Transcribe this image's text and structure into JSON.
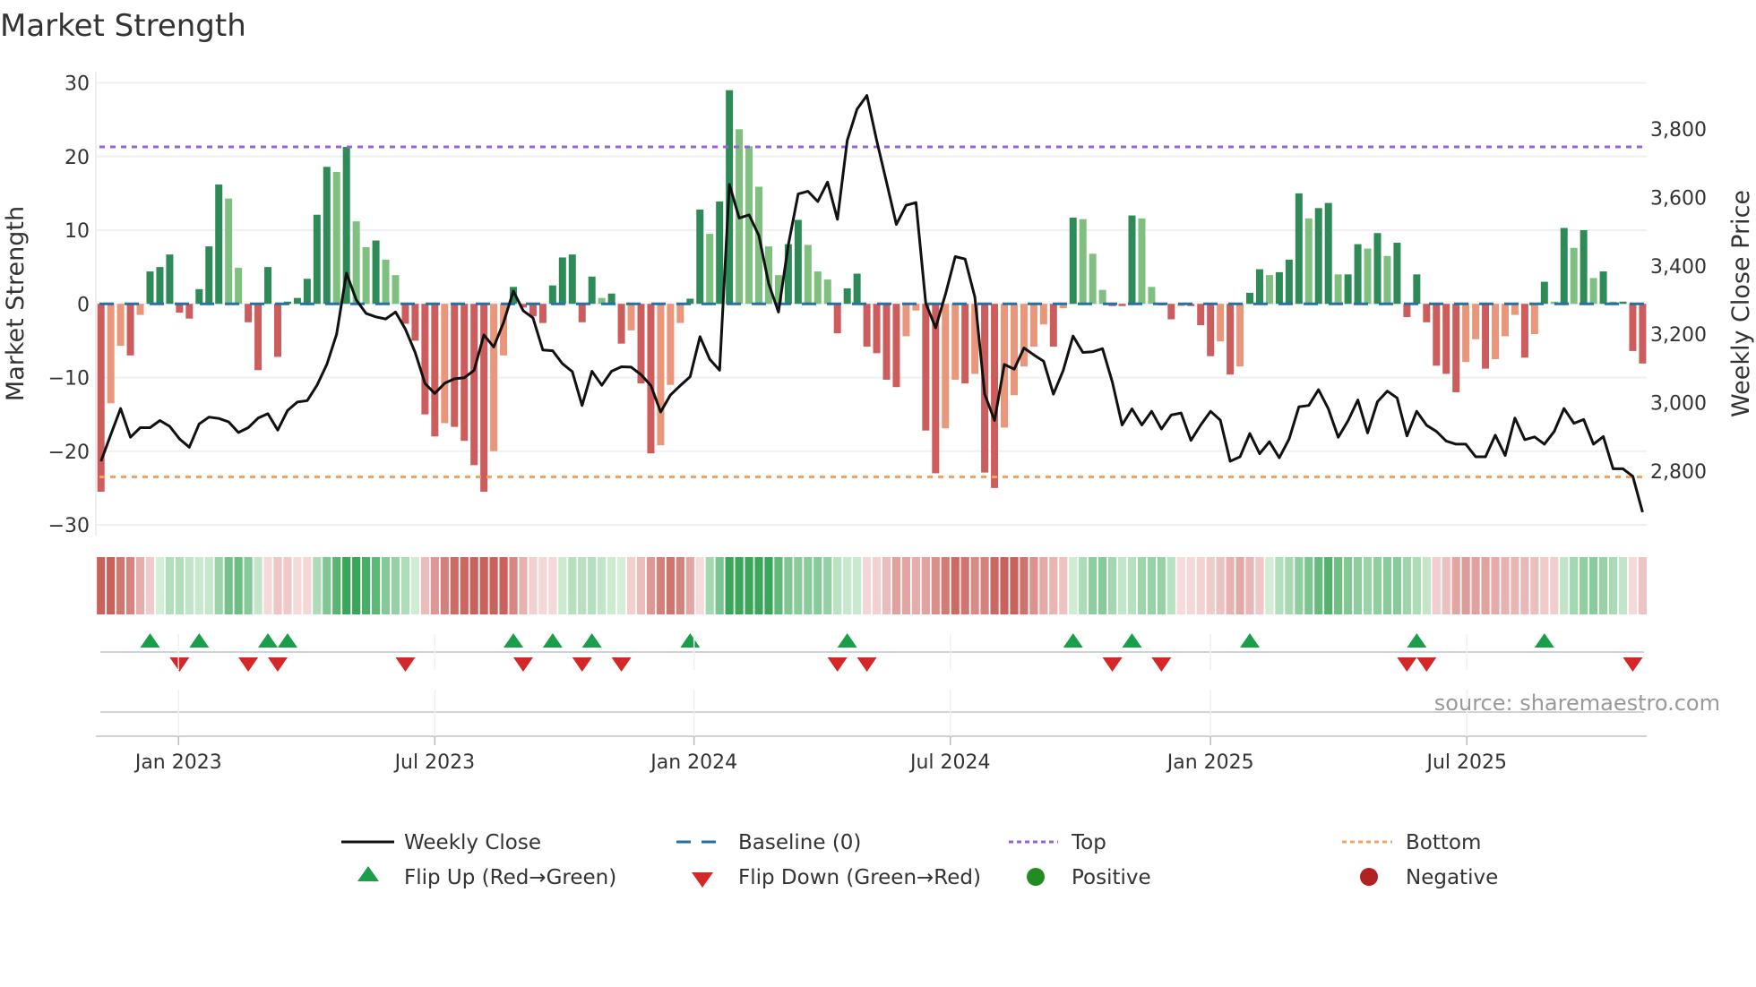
{
  "chart_data": {
    "type": "bar+line",
    "title": "Market Strength",
    "ylabel": "Market Strength",
    "y2label": "Weekly Close Price",
    "ylim": [
      -30,
      30
    ],
    "yticks": [
      {
        "value": 30,
        "label": "30"
      },
      {
        "value": 20,
        "label": "20"
      },
      {
        "value": 10,
        "label": "10"
      },
      {
        "value": 0,
        "label": "0"
      },
      {
        "value": -10,
        "label": "−10"
      },
      {
        "value": -20,
        "label": "−20"
      },
      {
        "value": -30,
        "label": "−30"
      }
    ],
    "y2lim": [
      2643,
      3935
    ],
    "y2ticks": [
      {
        "value": 2800,
        "label": "2,800"
      },
      {
        "value": 3000,
        "label": "3,000"
      },
      {
        "value": 3200,
        "label": "3,200"
      },
      {
        "value": 3400,
        "label": "3,400"
      },
      {
        "value": 3600,
        "label": "3,600"
      },
      {
        "value": 3800,
        "label": "3,800"
      }
    ],
    "xticks": [
      {
        "week": 7.9,
        "label": "Jan 2023"
      },
      {
        "week": 34.0,
        "label": "Jul 2023"
      },
      {
        "week": 60.4,
        "label": "Jan 2024"
      },
      {
        "week": 86.5,
        "label": "Jul 2024"
      },
      {
        "week": 113.0,
        "label": "Jan 2025"
      },
      {
        "week": 139.1,
        "label": "Jul 2025"
      }
    ],
    "top_level": 21.3,
    "bottom_level": -23.5,
    "baseline": 0,
    "strength": [
      -25.5,
      -13.5,
      -5.7,
      -7,
      -1.5,
      4.4,
      5,
      6.7,
      -1.2,
      -2,
      2,
      7.8,
      16.2,
      14.3,
      4.9,
      -2.5,
      -9,
      5,
      -7.2,
      0.3,
      0.8,
      3.4,
      12.1,
      18.6,
      17.9,
      21.3,
      11.2,
      7.7,
      8.6,
      6.0,
      3.9,
      -2.7,
      -5,
      -15,
      -18,
      -16.2,
      -16.7,
      -18.6,
      -21.9,
      -25.5,
      -20,
      -7,
      2.3,
      -0.5,
      -1.7,
      -2.6,
      2.5,
      6.3,
      6.7,
      -2.5,
      3.7,
      0.8,
      1.4,
      -5.4,
      -3.6,
      -10.8,
      -20.3,
      -19.2,
      -11,
      -2.6,
      0.7,
      12.8,
      9.5,
      13.9,
      29,
      23.7,
      21.4,
      15.9,
      7.8,
      3.9,
      8.1,
      11.4,
      8,
      4.4,
      3.3,
      -4,
      2.1,
      4.1,
      -5.8,
      -6.7,
      -10.3,
      -11.3,
      -4.4,
      -0.9,
      -17.2,
      -23,
      -16.9,
      -10.3,
      -10.8,
      -9.5,
      -22.9,
      -25,
      -16.8,
      -12.4,
      -8.5,
      -5.8,
      -2.8,
      -5.8,
      -0.6,
      11.7,
      11.5,
      6.8,
      1.9,
      -0.3,
      -0.3,
      12,
      11.6,
      2.3,
      -0.2,
      -2.1,
      -0.3,
      -0.3,
      -2.9,
      -7.1,
      -5.1,
      -9.6,
      -8.5,
      1.5,
      4.7,
      3.9,
      4.3,
      6,
      15,
      11.6,
      13,
      13.7,
      4,
      4,
      8.1,
      7.5,
      9.6,
      6.5,
      8.3,
      -1.8,
      4.0,
      -2.5,
      -8.4,
      -9.5,
      -12,
      -7.9,
      -4.8,
      -8.8,
      -7.5,
      -4.4,
      -1.5,
      -7.3,
      -4.1,
      3.0,
      0.3,
      10.3,
      7.6,
      10.0,
      3.5,
      4.4,
      0.3,
      0.3,
      -6.4,
      -8.1
    ],
    "close": [
      2829,
      2907,
      2983,
      2899,
      2927,
      2927,
      2948,
      2931,
      2894,
      2870,
      2938,
      2958,
      2954,
      2944,
      2913,
      2927,
      2955,
      2968,
      2920,
      2977,
      3002,
      3006,
      3051,
      3112,
      3200,
      3379,
      3300,
      3261,
      3251,
      3245,
      3265,
      3215,
      3147,
      3056,
      3027,
      3057,
      3070,
      3073,
      3095,
      3198,
      3163,
      3235,
      3326,
      3269,
      3248,
      3154,
      3152,
      3114,
      3091,
      2992,
      3092,
      3051,
      3092,
      3105,
      3104,
      3082,
      3050,
      2973,
      3023,
      3050,
      3076,
      3193,
      3127,
      3095,
      3638,
      3540,
      3549,
      3489,
      3348,
      3265,
      3461,
      3610,
      3618,
      3588,
      3645,
      3536,
      3767,
      3858,
      3898,
      3767,
      3645,
      3521,
      3577,
      3585,
      3291,
      3219,
      3317,
      3427,
      3420,
      3309,
      3025,
      2948,
      3112,
      3098,
      3160,
      3140,
      3121,
      3025,
      3095,
      3195,
      3147,
      3149,
      3158,
      3060,
      2935,
      2982,
      2935,
      2975,
      2923,
      2964,
      2970,
      2890,
      2935,
      2975,
      2949,
      2829,
      2842,
      2910,
      2851,
      2886,
      2839,
      2894,
      2988,
      2992,
      3038,
      2982,
      2899,
      2947,
      3008,
      2912,
      3003,
      3034,
      3014,
      2903,
      2975,
      2934,
      2916,
      2888,
      2879,
      2879,
      2842,
      2842,
      2905,
      2846,
      2955,
      2892,
      2900,
      2879,
      2916,
      2983,
      2940,
      2951,
      2879,
      2901,
      2807,
      2807,
      2785,
      2680
    ],
    "legend": {
      "placement": "bottom",
      "weekly_close": "Weekly Close",
      "baseline": "Baseline (0)",
      "top": "Top",
      "bottom": "Bottom",
      "flip_up": "Flip Up (Red→Green)",
      "flip_down": "Flip Down (Green→Red)",
      "positive": "Positive",
      "negative": "Negative"
    },
    "source": "source: sharemaestro.com",
    "colors": {
      "pos_strong": "#2e8b57",
      "pos_weak": "#7fbf7f",
      "neg_strong": "#cd5c5c",
      "neg_weak": "#e9967a",
      "top": "#9b5fd6",
      "bottom": "#f4a460",
      "baseline": "#2471a3",
      "flip_up": "#1a9e4a",
      "flip_down": "#d62728",
      "positive": "#228b22",
      "negative": "#b22222",
      "close": "#111111"
    }
  }
}
